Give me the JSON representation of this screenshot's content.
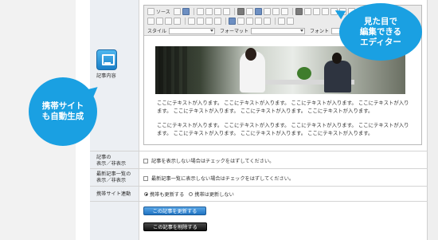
{
  "toolbar": {
    "source_label": "ソース",
    "style_label": "スタイル",
    "format_label": "フォーマット",
    "font_label": "フォント",
    "size_label": "サイ"
  },
  "editor": {
    "paragraphs": [
      "ここにテキストが入ります。 ここにテキストが入ります。 ここにテキストが入ります。 ここにテキストが入ります。 ここにテキストが入ります。 ここにテキストが入ります。 ここにテキストが入ります。",
      "ここにテキストが入ります。 ここにテキストが入ります。 ここにテキストが入ります。 ここにテキストが入ります。 ここにテキストが入ります。 ここにテキストが入ります。 ここにテキストが入ります。"
    ]
  },
  "labels": {
    "content": "記事内容",
    "article_visibility": "記事の\n表示／非表示",
    "latest_visibility": "最新記事一覧の\n表示／非表示",
    "mobile_link": "携帯サイト連動"
  },
  "checkboxes": {
    "hide_article": "記事を表示しない場合はチェックをはずしてください。",
    "hide_latest": "最新記事一覧に表示しない場合はチェックをはずしてください。"
  },
  "radio": {
    "opt_update": "携帯も更新する",
    "opt_noupdate": "携帯は更新しない"
  },
  "buttons": {
    "update": "この記事を更新する",
    "delete": "この記事を削除する"
  },
  "callouts": {
    "mobile": "携帯サイト\nも自動生成",
    "editor": "見た目で\n編集できる\nエディター"
  },
  "colors": {
    "accent_blue": "#1aa0e2",
    "update_button": "#1f73c2",
    "delete_button": "#111111"
  }
}
